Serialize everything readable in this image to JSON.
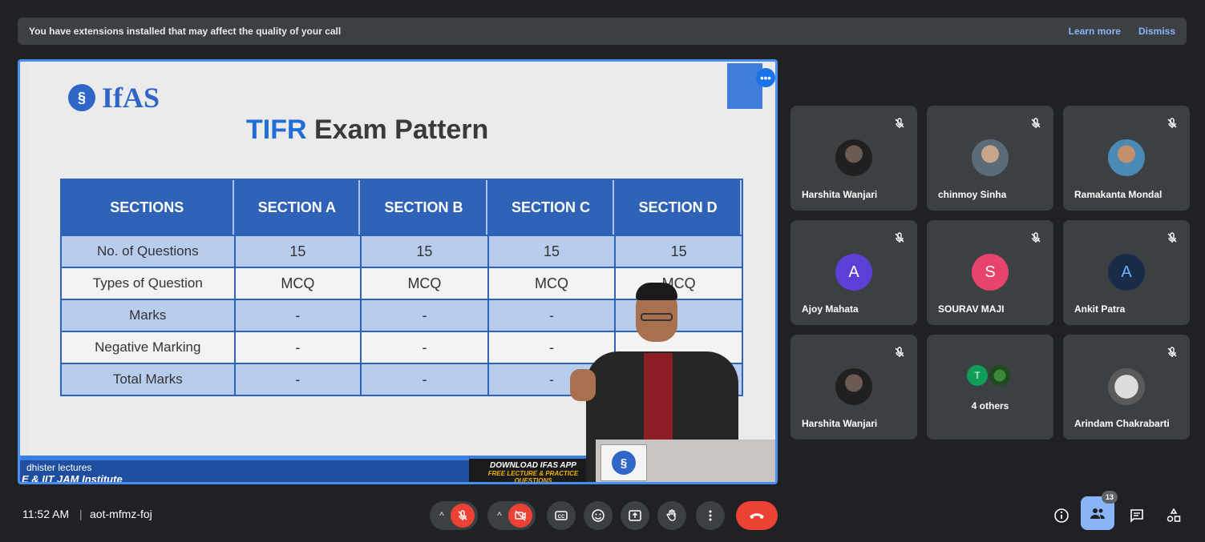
{
  "banner": {
    "message": "You have extensions installed that may affect the quality of your call",
    "learn_more": "Learn more",
    "dismiss": "Dismiss"
  },
  "slide": {
    "logo_text": "IfAS",
    "title_accent": "TIFR",
    "title_rest": " Exam Pattern",
    "table": {
      "headers": [
        "SECTIONS",
        "SECTION A",
        "SECTION B",
        "SECTION C",
        "SECTION D"
      ],
      "rows": [
        [
          "No. of Questions",
          "15",
          "15",
          "15",
          "15"
        ],
        [
          "Types of Question",
          "MCQ",
          "MCQ",
          "MCQ",
          "MCQ"
        ],
        [
          "Marks",
          "-",
          "-",
          "-",
          ""
        ],
        [
          "Negative Marking",
          "-",
          "-",
          "-",
          ""
        ],
        [
          "Total Marks",
          "-",
          "-",
          "-",
          ""
        ]
      ]
    },
    "footer_line1": "dhister lectures",
    "footer_line2": "E & IIT JAM Institute",
    "download_title": "DOWNLOAD IFAS APP",
    "download_sub": "FREE LECTURE & PRACTICE QUESTIONS",
    "more_label": "•••"
  },
  "participants": [
    {
      "name": "Harshita Wanjari",
      "avatar": "photo-dark",
      "muted": true
    },
    {
      "name": "chinmoy Sinha",
      "avatar": "photo-mid",
      "muted": true
    },
    {
      "name": "Ramakanta Mondal",
      "avatar": "photo-blue",
      "muted": true
    },
    {
      "name": "Ajoy Mahata",
      "avatar_letter": "A",
      "avatar_color": "#5b3fd6",
      "muted": true
    },
    {
      "name": "SOURAV MAJI",
      "avatar_letter": "S",
      "avatar_color": "#e8436d",
      "muted": true
    },
    {
      "name": "Ankit Patra",
      "avatar_letter": "A",
      "avatar_color": "#1a2b47",
      "muted": true
    },
    {
      "name": "Harshita Wanjari",
      "avatar": "photo-dark",
      "muted": true
    },
    {
      "others_label": "4 others",
      "mini_letter": "T"
    },
    {
      "name": "Arindam Chakrabarti",
      "avatar": "photo-bw",
      "muted": true
    }
  ],
  "bottom": {
    "time": "11:52 AM",
    "separator": "|",
    "meeting_code": "aot-mfmz-foj",
    "people_count": "13"
  },
  "colors": {
    "accent": "#8ab4f8",
    "danger": "#ea4335",
    "surface": "#3c4043",
    "background": "#202124",
    "slide_blue": "#2f63b8"
  }
}
